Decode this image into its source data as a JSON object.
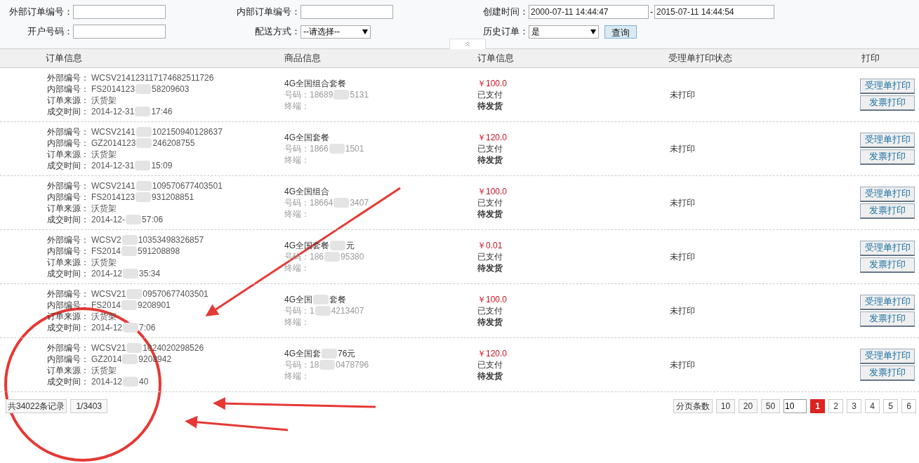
{
  "filters": {
    "external_order_label": "外部订单编号：",
    "internal_order_label": "内部订单编号：",
    "created_label": "创建时间：",
    "created_from": "2000-07-11 14:44:47",
    "range_dash": "-",
    "created_to": "2015-07-11 14:44:54",
    "account_label": "开户号码：",
    "delivery_label": "配送方式：",
    "delivery_value": "--请选择--",
    "history_label": "历史订单：",
    "history_value": "是",
    "query_button": "查询"
  },
  "columns": [
    "订单信息",
    "商品信息",
    "订单信息",
    "受理单打印状态",
    "打印"
  ],
  "rows": [
    {
      "fields": [
        {
          "label": "外部编号：",
          "value": [
            "WCSV214123117174682511726"
          ]
        },
        {
          "label": "内部编号：",
          "value": [
            "FS2014123",
            "58209603"
          ]
        },
        {
          "label": "订单来源：",
          "value": [
            "沃货架"
          ]
        },
        {
          "label": "成交时间：",
          "value": [
            "2014-12-31",
            "17:46"
          ]
        }
      ],
      "product": [
        "4G全国组合套餐"
      ],
      "phone_label": "号码：",
      "phone": [
        "18689",
        "5131"
      ],
      "terminal_label": "终端：",
      "price": "￥100.0",
      "paid": "已支付",
      "shipping": "待发货",
      "print_status": "未打印",
      "buttons": [
        "受理单打印",
        "发票打印"
      ]
    },
    {
      "fields": [
        {
          "label": "外部编号：",
          "value": [
            "WCSV2141",
            "102150940128637"
          ]
        },
        {
          "label": "内部编号：",
          "value": [
            "GZ2014123",
            "246208755"
          ]
        },
        {
          "label": "订单来源：",
          "value": [
            "沃货架"
          ]
        },
        {
          "label": "成交时间：",
          "value": [
            "2014-12-31",
            "15:09"
          ]
        }
      ],
      "product": [
        "4G全国套餐"
      ],
      "phone_label": "号码：",
      "phone": [
        "1866",
        "1501"
      ],
      "terminal_label": "终端：",
      "price": "￥120.0",
      "paid": "已支付",
      "shipping": "待发货",
      "print_status": "未打印",
      "buttons": [
        "受理单打印",
        "发票打印"
      ]
    },
    {
      "fields": [
        {
          "label": "外部编号：",
          "value": [
            "WCSV2141",
            "109570677403501"
          ]
        },
        {
          "label": "内部编号：",
          "value": [
            "FS2014123",
            "931208851"
          ]
        },
        {
          "label": "订单来源：",
          "value": [
            "沃货架"
          ]
        },
        {
          "label": "成交时间：",
          "value": [
            "2014-12-",
            "57:06"
          ]
        }
      ],
      "product": [
        "4G全国组合"
      ],
      "phone_label": "号码：",
      "phone": [
        "18664",
        "3407"
      ],
      "terminal_label": "终端：",
      "price": "￥100.0",
      "paid": "已支付",
      "shipping": "待发货",
      "print_status": "未打印",
      "buttons": [
        "受理单打印",
        "发票打印"
      ]
    },
    {
      "fields": [
        {
          "label": "外部编号：",
          "value": [
            "WCSV2",
            "10353498326857"
          ]
        },
        {
          "label": "内部编号：",
          "value": [
            "FS2014",
            "591208898"
          ]
        },
        {
          "label": "订单来源：",
          "value": [
            "沃货架"
          ]
        },
        {
          "label": "成交时间：",
          "value": [
            "2014-12",
            "35:34"
          ]
        }
      ],
      "product": [
        "4G全国套餐",
        "元"
      ],
      "phone_label": "号码：",
      "phone": [
        "186",
        "95380"
      ],
      "terminal_label": "终端：",
      "price": "￥0.01",
      "paid": "已支付",
      "shipping": "待发货",
      "print_status": "未打印",
      "buttons": [
        "受理单打印",
        "发票打印"
      ]
    },
    {
      "fields": [
        {
          "label": "外部编号：",
          "value": [
            "WCSV21",
            "09570677403501"
          ]
        },
        {
          "label": "内部编号：",
          "value": [
            "FS2014",
            "9208901"
          ]
        },
        {
          "label": "订单来源：",
          "value": [
            "沃货架"
          ]
        },
        {
          "label": "成交时间：",
          "value": [
            "2014-12",
            "7:06"
          ]
        }
      ],
      "product": [
        "4G全国",
        "套餐"
      ],
      "phone_label": "号码：",
      "phone": [
        "1",
        "4213407"
      ],
      "terminal_label": "终端：",
      "price": "￥100.0",
      "paid": "已支付",
      "shipping": "待发货",
      "print_status": "未打印",
      "buttons": [
        "受理单打印",
        "发票打印"
      ]
    },
    {
      "fields": [
        {
          "label": "外部编号：",
          "value": [
            "WCSV21",
            "1024020298526"
          ]
        },
        {
          "label": "内部编号：",
          "value": [
            "GZ2014",
            "9208942"
          ]
        },
        {
          "label": "订单来源：",
          "value": [
            "沃货架"
          ]
        },
        {
          "label": "成交时间：",
          "value": [
            "2014-12",
            "40"
          ]
        }
      ],
      "product": [
        "4G全国套",
        "76元"
      ],
      "phone_label": "号码：",
      "phone": [
        "18",
        "0478796"
      ],
      "terminal_label": "终端：",
      "price": "￥120.0",
      "paid": "已支付",
      "shipping": "待发货",
      "print_status": "未打印",
      "buttons": [
        "受理单打印",
        "发票打印"
      ]
    }
  ],
  "footer": {
    "total": "共34022条记录",
    "page_of": "1/3403",
    "page_size_label": "分页条数",
    "sizes": [
      "10",
      "20",
      "50"
    ],
    "size_input": "10",
    "pages": [
      {
        "label": "1",
        "selected": true
      },
      {
        "label": "2",
        "selected": false
      },
      {
        "label": "3",
        "selected": false
      },
      {
        "label": "4",
        "selected": false
      },
      {
        "label": "5",
        "selected": false
      },
      {
        "label": "6",
        "selected": false
      }
    ]
  }
}
